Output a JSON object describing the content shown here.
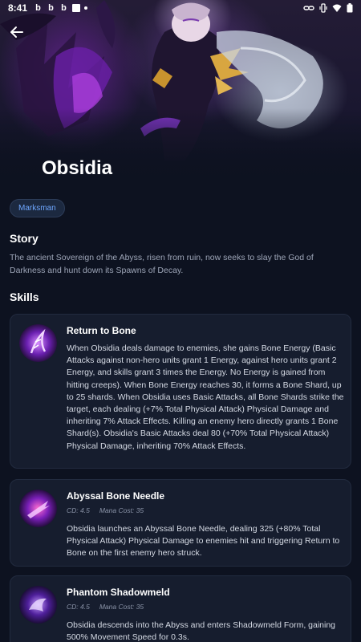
{
  "status_bar": {
    "time": "8:41",
    "notifications": [
      "b",
      "b",
      "b"
    ]
  },
  "hero": {
    "title": "Obsidia"
  },
  "role_chip": "Marksman",
  "story": {
    "heading": "Story",
    "text": "The ancient Sovereign of the Abyss, risen from ruin, now seeks to slay the God of Darkness and hunt down its Spawns of Decay."
  },
  "skills": {
    "heading": "Skills",
    "items": [
      {
        "name": "Return to Bone",
        "description": "When Obsidia deals damage to enemies, she gains Bone Energy (Basic Attacks against non-hero units grant 1 Energy, against hero units grant 2 Energy, and skills grant 3 times the Energy. No Energy is gained from hitting creeps). When Bone Energy reaches 30, it forms a Bone Shard, up to 25 shards. When Obsidia uses Basic Attacks, all Bone Shards strike the target, each dealing (+7% Total Physical Attack) Physical Damage and inheriting 7% Attack Effects. Killing an enemy hero directly grants 1 Bone Shard(s). Obsidia's Basic Attacks deal 80 (+70% Total Physical Attack) Physical Damage, inheriting 70% Attack Effects."
      },
      {
        "name": "Abyssal Bone Needle",
        "cd": "CD: 4.5",
        "mana": "Mana Cost: 35",
        "description": "Obsidia launches an Abyssal Bone Needle, dealing 325 (+80% Total Physical Attack) Physical Damage to enemies hit and triggering Return to Bone on the first enemy hero struck."
      },
      {
        "name": "Phantom Shadowmeld",
        "cd": "CD: 4.5",
        "mana": "Mana Cost: 35",
        "description": "Obsidia descends into the Abyss and enters Shadowmeld Form, gaining 500% Movement Speed for 0.3s."
      }
    ]
  },
  "colors": {
    "background": "#0d1220",
    "card": "#161d2e",
    "chip_text": "#6ea7ff"
  },
  "icons": [
    "back-arrow-icon",
    "skill-icon-return-to-bone",
    "skill-icon-abyssal-bone-needle",
    "skill-icon-phantom-shadowmeld"
  ]
}
